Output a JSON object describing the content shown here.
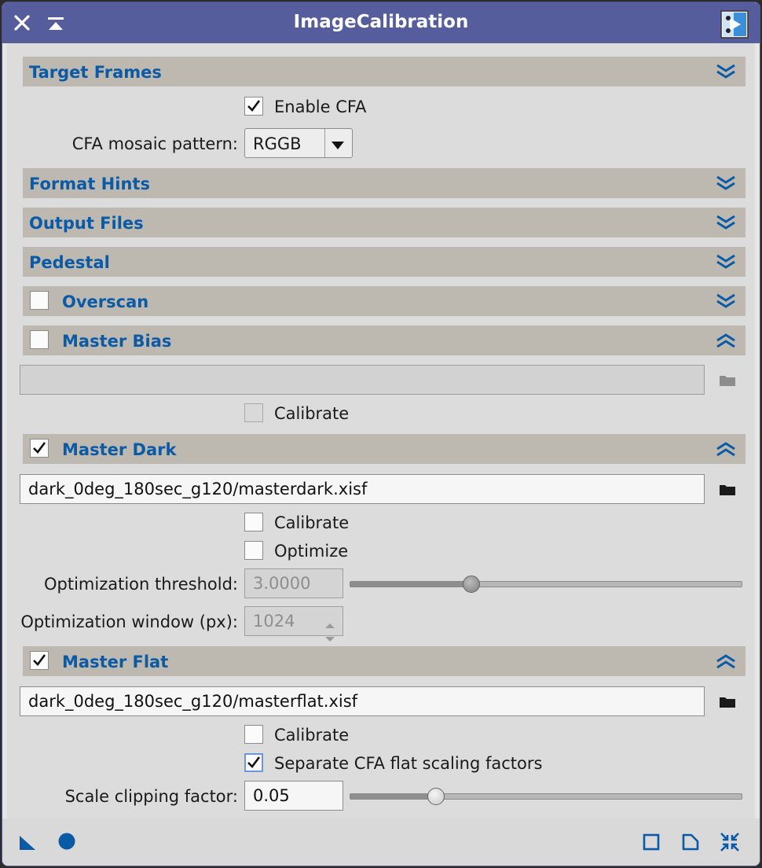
{
  "window": {
    "title": "ImageCalibration"
  },
  "target_frames": {
    "title": "Target Frames",
    "enable_cfa_label": "Enable CFA",
    "enable_cfa_checked": true,
    "cfa_pattern_label": "CFA mosaic pattern:",
    "cfa_pattern_value": "RGGB"
  },
  "format_hints": {
    "title": "Format Hints"
  },
  "output_files": {
    "title": "Output Files"
  },
  "pedestal": {
    "title": "Pedestal"
  },
  "overscan": {
    "title": "Overscan",
    "enabled": false
  },
  "master_bias": {
    "title": "Master Bias",
    "enabled": false,
    "path": "",
    "calibrate_label": "Calibrate",
    "calibrate_checked": false
  },
  "master_dark": {
    "title": "Master Dark",
    "enabled": true,
    "path": "dark_0deg_180sec_g120/masterdark.xisf",
    "calibrate_label": "Calibrate",
    "calibrate_checked": false,
    "optimize_label": "Optimize",
    "optimize_checked": false,
    "threshold_label": "Optimization threshold:",
    "threshold_value": "3.0000",
    "threshold_slider": 0.31,
    "window_label": "Optimization window (px):",
    "window_value": "1024"
  },
  "master_flat": {
    "title": "Master Flat",
    "enabled": true,
    "path": "dark_0deg_180sec_g120/masterflat.xisf",
    "calibrate_label": "Calibrate",
    "calibrate_checked": false,
    "separate_cfa_label": "Separate CFA flat scaling factors",
    "separate_cfa_checked": true,
    "scale_clipping_label": "Scale clipping factor:",
    "scale_clipping_value": "0.05",
    "scale_clipping_slider": 0.22
  },
  "colors": {
    "title_bar": "#565d9d",
    "section_header": "#bdb9b1",
    "section_label": "#0b5aa6",
    "accent_icon": "#0b5aa6"
  },
  "icons": [
    "close-icon",
    "shade-icon",
    "process-icon",
    "collapse-all-icon",
    "expand-icon",
    "folder-icon",
    "new-instance-icon",
    "apply-global-icon",
    "preview-icon",
    "reset-icon",
    "track-view-icon"
  ]
}
